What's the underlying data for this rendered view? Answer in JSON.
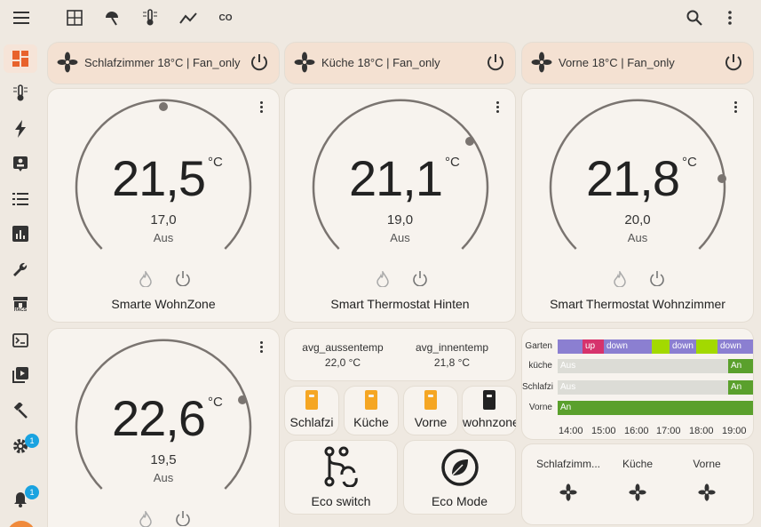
{
  "topbar": {
    "icons": [
      "dashboard-view-icon",
      "weather-umbrella-icon",
      "thermostat-icon",
      "chart-line-icon",
      "co2-icon"
    ],
    "co2_label": "CO",
    "search_icon": "search-icon",
    "menu_icon": "more-vert-icon"
  },
  "sidebar": {
    "items": [
      "overview-icon",
      "climate-icon",
      "energy-icon",
      "logbook-icon",
      "todo-list-icon",
      "history-icon",
      "tools-icon",
      "hacs-icon",
      "terminal-icon",
      "media-icon",
      "developer-tools-icon",
      "settings-icon"
    ],
    "hacs_label": "HACS",
    "settings_badge": "1",
    "notifications_badge": "1"
  },
  "header_cards": [
    {
      "text": "Schlafzimmer 18°C | Fan_only"
    },
    {
      "text": "Küche 18°C | Fan_only"
    },
    {
      "text": "Vorne 18°C | Fan_only"
    }
  ],
  "thermostats": [
    {
      "name": "Smarte WohnZone",
      "temp": "21,5",
      "unit": "°C",
      "target": "17,0",
      "mode": "Aus"
    },
    {
      "name": "Smart Thermostat Hinten",
      "temp": "21,1",
      "unit": "°C",
      "target": "19,0",
      "mode": "Aus"
    },
    {
      "name": "Smart Thermostat Wohnzimmer",
      "temp": "21,8",
      "unit": "°C",
      "target": "20,0",
      "mode": "Aus"
    },
    {
      "name": "",
      "temp": "22,6",
      "unit": "°C",
      "target": "19,5",
      "mode": "Aus"
    }
  ],
  "sensors": {
    "outside_label": "avg_aussentemp",
    "outside_value": "22,0 °C",
    "inside_label": "avg_innentemp",
    "inside_value": "21,8 °C"
  },
  "window_buttons": [
    {
      "label": "Schlafzi",
      "color": "#f5a623"
    },
    {
      "label": "Küche",
      "color": "#f5a623"
    },
    {
      "label": "Vorne",
      "color": "#f5a623"
    },
    {
      "label": "wohnzone",
      "color": "#222222"
    }
  ],
  "big_buttons": [
    {
      "label": "Eco switch"
    },
    {
      "label": "Eco Mode"
    }
  ],
  "timeline": {
    "rows": [
      {
        "label": "Garten",
        "segments": [
          {
            "text": "",
            "color": "#8b7fd1"
          },
          {
            "text": "up",
            "color": "#d6336c"
          },
          {
            "text": "down",
            "color": "#8b7fd1"
          },
          {
            "text": "",
            "color": "#a3d900"
          },
          {
            "text": "down",
            "color": "#8b7fd1"
          },
          {
            "text": "",
            "color": "#a3d900"
          },
          {
            "text": "down",
            "color": "#8b7fd1"
          }
        ]
      },
      {
        "label": "küche",
        "segments": [
          {
            "text": "Aus",
            "color": "#dcdcd6"
          },
          {
            "text": "An",
            "color": "#5aa02c"
          }
        ]
      },
      {
        "label": "Schlafzi",
        "segments": [
          {
            "text": "Aus",
            "color": "#dcdcd6"
          },
          {
            "text": "An",
            "color": "#5aa02c"
          }
        ]
      },
      {
        "label": "Vorne",
        "segments": [
          {
            "text": "An",
            "color": "#5aa02c"
          }
        ]
      }
    ],
    "ticks": [
      "14:00",
      "15:00",
      "16:00",
      "17:00",
      "18:00",
      "19:00"
    ]
  },
  "fans": [
    {
      "label": "Schlafzimm..."
    },
    {
      "label": "Küche"
    },
    {
      "label": "Vorne"
    }
  ]
}
